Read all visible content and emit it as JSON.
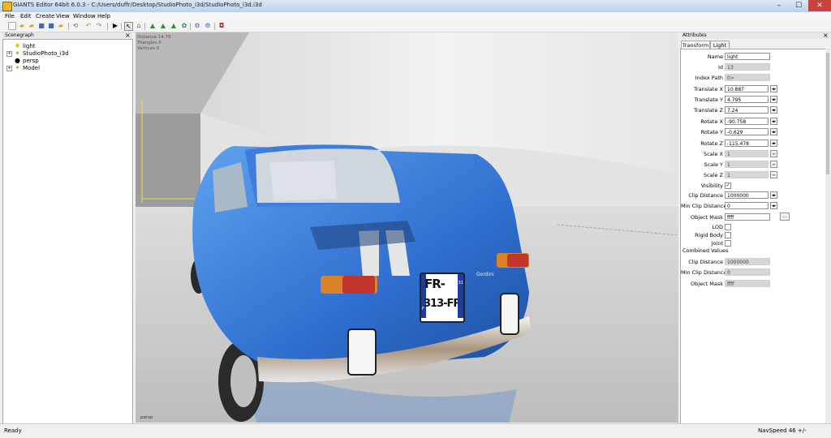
{
  "window": {
    "title": "GIANTS Editor 64bit 6.0.3 - C:/Users/duffr/Desktop/StudioPhoto_i3d/StudioPhoto_i3d.i3d",
    "min": "–",
    "max": "☐",
    "close": "✕"
  },
  "menu": [
    "File",
    "Edit",
    "Create",
    "View",
    "Window",
    "Help"
  ],
  "scenegraph": {
    "title": "Scenegraph",
    "nodes": [
      {
        "label": "light",
        "icon": "light-bulb-icon"
      },
      {
        "label": "StudioPhoto_i3d",
        "icon": "transform-group-icon"
      },
      {
        "label": "persp",
        "icon": "camera-icon"
      },
      {
        "label": "Model",
        "icon": "transform-group-icon"
      }
    ]
  },
  "viewport": {
    "stats": [
      "Distance 14.79",
      "Triangles 0",
      "Vertices 0"
    ],
    "camera_label": "persp",
    "plate_line1": "FR-",
    "plate_line2": "313-FR",
    "plate_region": "31",
    "plate_country": "F",
    "badge_text": "Gordini"
  },
  "attributes": {
    "title": "Attributes",
    "tabs": [
      "Transform",
      "Light"
    ],
    "fields": {
      "name": {
        "label": "Name",
        "value": "light"
      },
      "id": {
        "label": "Id",
        "value": "13"
      },
      "index_path": {
        "label": "Index Path",
        "value": "0>"
      },
      "tx": {
        "label": "Translate X",
        "value": "10.887"
      },
      "ty": {
        "label": "Translate Y",
        "value": "4.795"
      },
      "tz": {
        "label": "Translate Z",
        "value": "7.24"
      },
      "rx": {
        "label": "Rotate X",
        "value": "-90.758"
      },
      "ry": {
        "label": "Rotate Y",
        "value": "-0.629"
      },
      "rz": {
        "label": "Rotate Z",
        "value": "-115.478"
      },
      "sx": {
        "label": "Scale X",
        "value": "1"
      },
      "sy": {
        "label": "Scale Y",
        "value": "1"
      },
      "sz": {
        "label": "Scale Z",
        "value": "1"
      },
      "visibility": {
        "label": "Visibility",
        "checked": true
      },
      "clip": {
        "label": "Clip Distance",
        "value": "1000000"
      },
      "min_clip": {
        "label": "Min Clip Distance",
        "value": "0"
      },
      "object_mask": {
        "label": "Object Mask",
        "value": "ffff"
      },
      "lod": {
        "label": "LOD",
        "checked": false
      },
      "rigid": {
        "label": "Rigid Body",
        "checked": false
      },
      "joint": {
        "label": "Joint",
        "checked": false
      }
    },
    "combined": {
      "heading": "Combined Values",
      "clip": {
        "label": "Clip Distance",
        "value": "1000000"
      },
      "min_clip": {
        "label": "Min Clip Distance",
        "value": "0"
      },
      "object_mask": {
        "label": "Object Mask",
        "value": "ffff"
      }
    },
    "spin_glyph": "◂▸",
    "browse_glyph": "...",
    "check_glyph": "✓"
  },
  "status": {
    "left": "Ready",
    "right": "NavSpeed 46 +/-"
  },
  "colors": {
    "car_blue": "#2f6fd0",
    "title_gradient": "#b9d1ea",
    "close_red": "#c7433b"
  }
}
